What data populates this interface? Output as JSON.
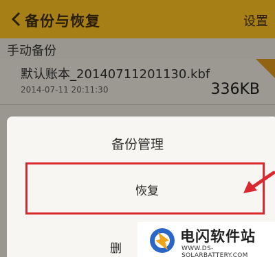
{
  "header": {
    "title": "备份与恢复",
    "settings_label": "设置"
  },
  "section": {
    "title": "手动备份"
  },
  "backup_file": {
    "name": "默认账本_20140711201130.kbf",
    "date": "2014-07-11 20:11:30",
    "size": "336KB"
  },
  "dialog": {
    "title": "备份管理",
    "restore_label": "恢复",
    "delete_label": "删"
  },
  "watermark": {
    "brand": "电闪软件站",
    "url": "WWW.DS-SOLARBATTERY.COM"
  },
  "colors": {
    "header_bg": "#e7b21f",
    "highlight_border": "#d9282f",
    "arrow": "#d9282f"
  }
}
